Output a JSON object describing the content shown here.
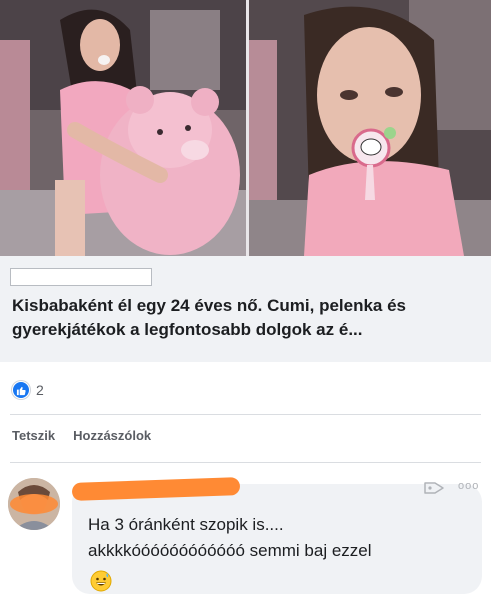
{
  "post": {
    "link_headline": "Kisbabaként él egy 24 éves nő. Cumi, pelenka és gyerekjátékok a legfontosabb dolgok az é...",
    "reaction_icon": "like-thumb-icon",
    "reaction_count": "2",
    "actions": {
      "like_label": "Tetszik",
      "comment_label": "Hozzászólok"
    }
  },
  "comment": {
    "text_line1": "Ha 3 óránként szopik is....",
    "text_line2": "akkkkóóóóóóóóóóóó semmi baj ezzel",
    "emoji": "grinning-sweat-emoji",
    "more_options": "ooo"
  },
  "colors": {
    "accent": "#1877f2",
    "redaction": "#ff8a34",
    "card_background": "#f0f2f5"
  }
}
